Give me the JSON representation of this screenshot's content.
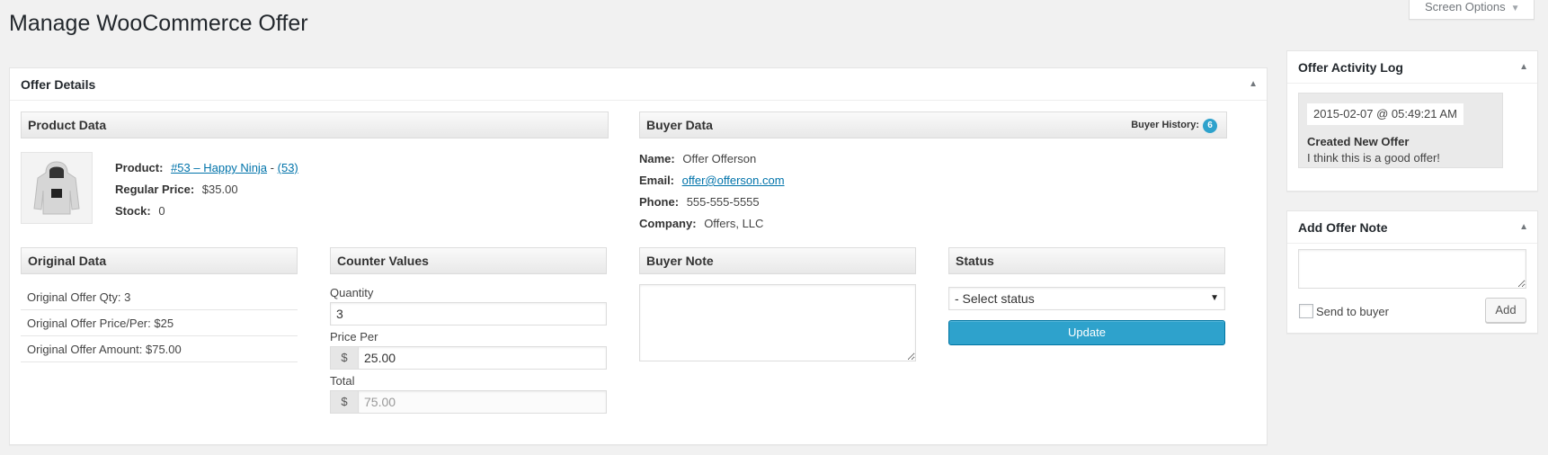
{
  "page": {
    "title": "Manage WooCommerce Offer",
    "screen_options": "Screen Options"
  },
  "offer_details": {
    "title": "Offer Details",
    "product": {
      "heading": "Product Data",
      "image_icon": "hoodie-product-image",
      "product_label": "Product:",
      "product_link": "#53 – Happy Ninja",
      "separator": "-",
      "product_id_link": "(53)",
      "price_label": "Regular Price:",
      "price_value": "$35.00",
      "stock_label": "Stock:",
      "stock_value": "0"
    },
    "buyer": {
      "heading": "Buyer Data",
      "history_label": "Buyer History:",
      "history_count": "6",
      "name_label": "Name:",
      "name_value": "Offer Offerson",
      "email_label": "Email:",
      "email_value": "offer@offerson.com",
      "phone_label": "Phone:",
      "phone_value": "555-555-5555",
      "company_label": "Company:",
      "company_value": "Offers, LLC"
    },
    "original": {
      "heading": "Original Data",
      "lines": [
        "Original Offer Qty: 3",
        "Original Offer Price/Per: $25",
        "Original Offer Amount: $75.00"
      ]
    },
    "counter": {
      "heading": "Counter Values",
      "quantity_label": "Quantity",
      "quantity_value": "3",
      "price_label": "Price Per",
      "currency": "$",
      "price_value": "25.00",
      "total_label": "Total",
      "total_value": "75.00"
    },
    "buyer_note": {
      "heading": "Buyer Note",
      "value": ""
    },
    "status": {
      "heading": "Status",
      "selected": "- Select status",
      "update_label": "Update"
    }
  },
  "activity_log": {
    "title": "Offer Activity Log",
    "date": "2015-02-07 @ 05:49:21 AM",
    "event": "Created New Offer",
    "note": "I think this is a good offer!"
  },
  "add_note": {
    "title": "Add Offer Note",
    "send_label": "Send to buyer",
    "add_label": "Add"
  },
  "colors": {
    "accent": "#2ea2cc",
    "link": "#0073aa",
    "background": "#f1f1f1"
  }
}
